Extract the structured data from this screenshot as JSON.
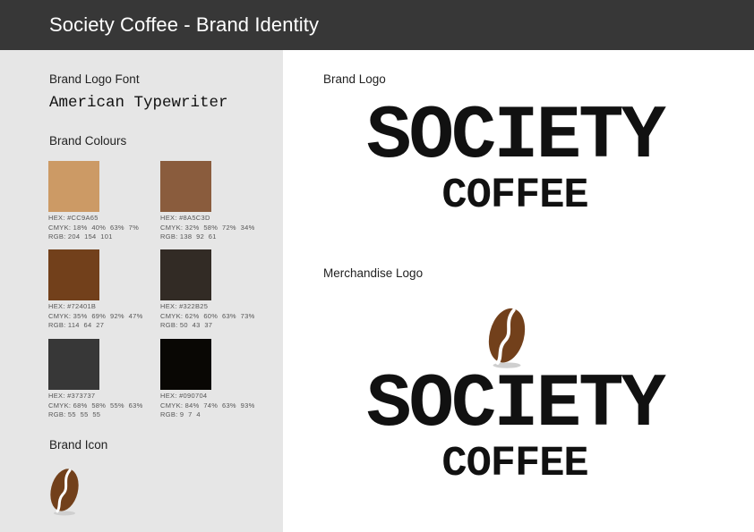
{
  "header": {
    "title": "Society Coffee - Brand Identity"
  },
  "left": {
    "font_heading": "Brand Logo Font",
    "font_name": "American Typewriter",
    "colours_heading": "Brand Colours",
    "icon_heading": "Brand Icon"
  },
  "colours": [
    {
      "hex_color": "#CC9A65",
      "hex": "HEX: #CC9A65",
      "cmyk": "CMYK: 18%  40%  63%  7%",
      "rgb": "RGB: 204  154  101"
    },
    {
      "hex_color": "#8A5C3D",
      "hex": "HEX: #8A5C3D",
      "cmyk": "CMYK: 32%  58%  72%  34%",
      "rgb": "RGB: 138  92  61"
    },
    {
      "hex_color": "#72401B",
      "hex": "HEX: #72401B",
      "cmyk": "CMYK: 35%  69%  92%  47%",
      "rgb": "RGB: 114  64  27"
    },
    {
      "hex_color": "#322B25",
      "hex": "HEX: #322B25",
      "cmyk": "CMYK: 62%  60%  63%  73%",
      "rgb": "RGB: 50  43  37"
    },
    {
      "hex_color": "#373737",
      "hex": "HEX: #373737",
      "cmyk": "CMYK: 68%  58%  55%  63%",
      "rgb": "RGB: 55  55  55"
    },
    {
      "hex_color": "#090704",
      "hex": "HEX: #090704",
      "cmyk": "CMYK: 84%  74%  63%  93%",
      "rgb": "RGB: 9  7  4"
    }
  ],
  "right": {
    "brand_logo_heading": "Brand Logo",
    "merch_logo_heading": "Merchandise Logo"
  },
  "logo": {
    "line1": "SOCIETY",
    "line2": "COFFEE"
  },
  "icons": {
    "bean": "coffee-bean-icon",
    "bean_color": "#72401B"
  }
}
